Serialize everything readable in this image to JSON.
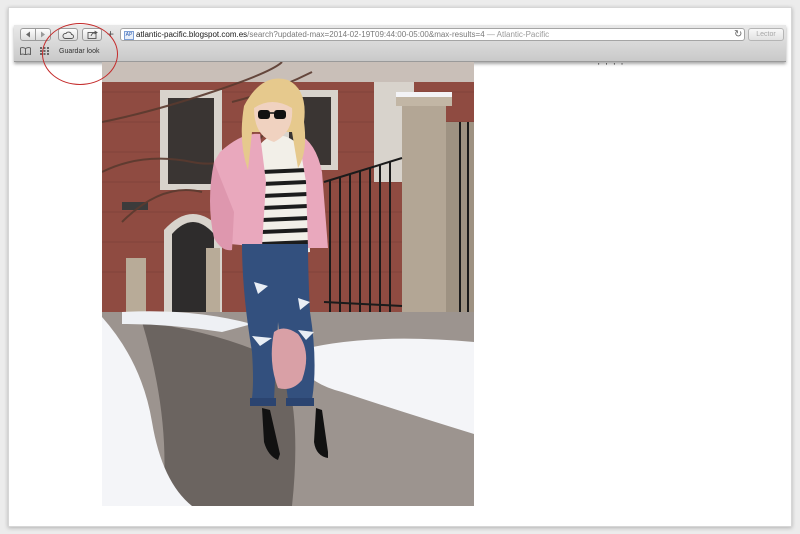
{
  "browser": {
    "address": {
      "host": "atlantic-pacific.blogspot.com.es",
      "path": "/search?updated-max=2014-02-19T09:44:00-05:00&max-results=4",
      "separator": " — ",
      "page_title": "Atlantic-Pacific",
      "favicon_text": "AP"
    },
    "add_symbol": "+",
    "reload_symbol": "↻",
    "reader_label": "Lector",
    "bookmarks": [
      {
        "label": "Guardar look"
      }
    ]
  },
  "annotation": {
    "circle_color": "#c42a2a"
  },
  "content": {
    "photo_alt": "Woman in pink jacket, striped top and ripped jeans on a snowy sidewalk",
    "stray_marks": "' ' ' '"
  },
  "colors": {
    "toolbar_top": "#e9e9e9",
    "toolbar_bottom": "#c9c9c9",
    "jacket": "#e9a8bd",
    "jeans": "#33507e",
    "brick": "#8f4b41",
    "snow": "#f4f5f8"
  }
}
